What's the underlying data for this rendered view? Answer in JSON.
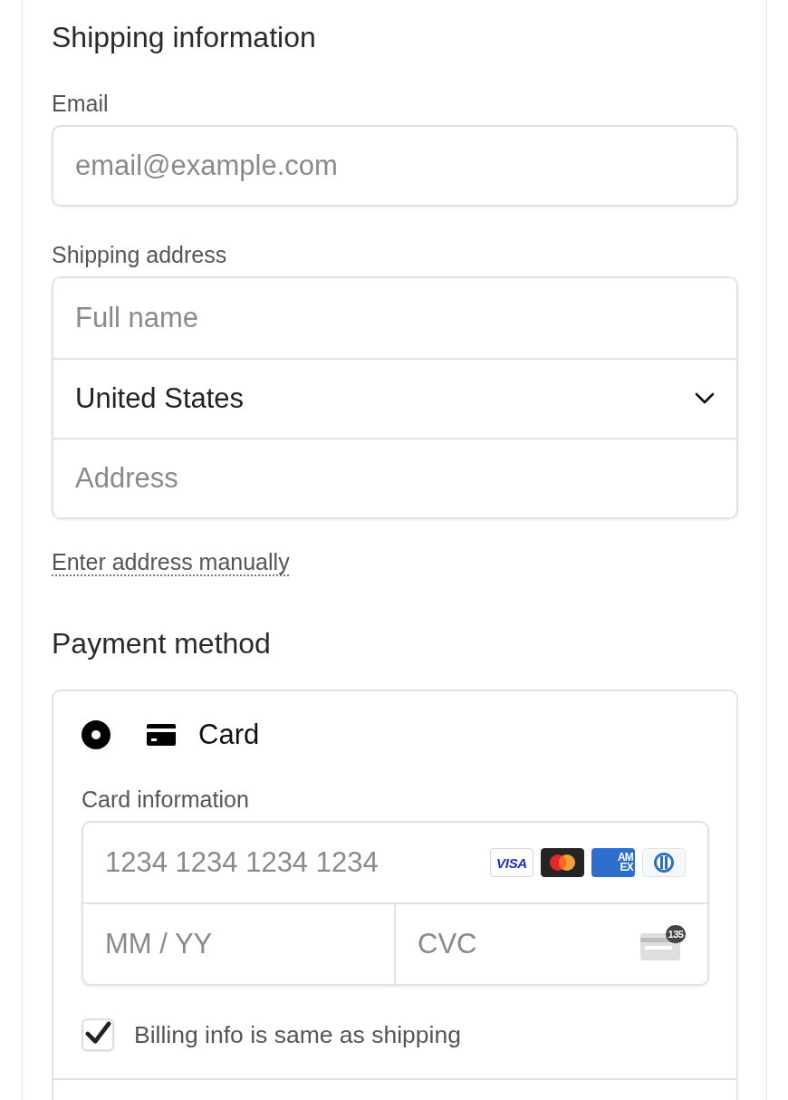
{
  "shipping": {
    "title": "Shipping information",
    "email": {
      "label": "Email",
      "placeholder": "email@example.com"
    },
    "address": {
      "label": "Shipping address",
      "fields": [
        {
          "kind": "text",
          "placeholder": "Full name"
        },
        {
          "kind": "select",
          "value": "United States"
        },
        {
          "kind": "text",
          "placeholder": "Address"
        }
      ]
    },
    "manual_link": "Enter address manually"
  },
  "payment": {
    "title": "Payment method",
    "methods": [
      {
        "kind": "card",
        "label": "Card",
        "selected": true
      }
    ],
    "card_info": {
      "label": "Card information",
      "number_placeholder": "1234 1234 1234 1234",
      "brands": [
        {
          "kind": "visa",
          "lines": [
            "VISA"
          ]
        },
        {
          "kind": "mastercard"
        },
        {
          "kind": "amex",
          "lines": [
            "AM",
            "EX"
          ]
        },
        {
          "kind": "diners"
        }
      ],
      "expiry_placeholder": "MM / YY",
      "cvc_placeholder": "CVC",
      "cvc_badge": "135"
    },
    "billing_same": {
      "label": "Billing info is same as shipping",
      "checked": true
    }
  }
}
